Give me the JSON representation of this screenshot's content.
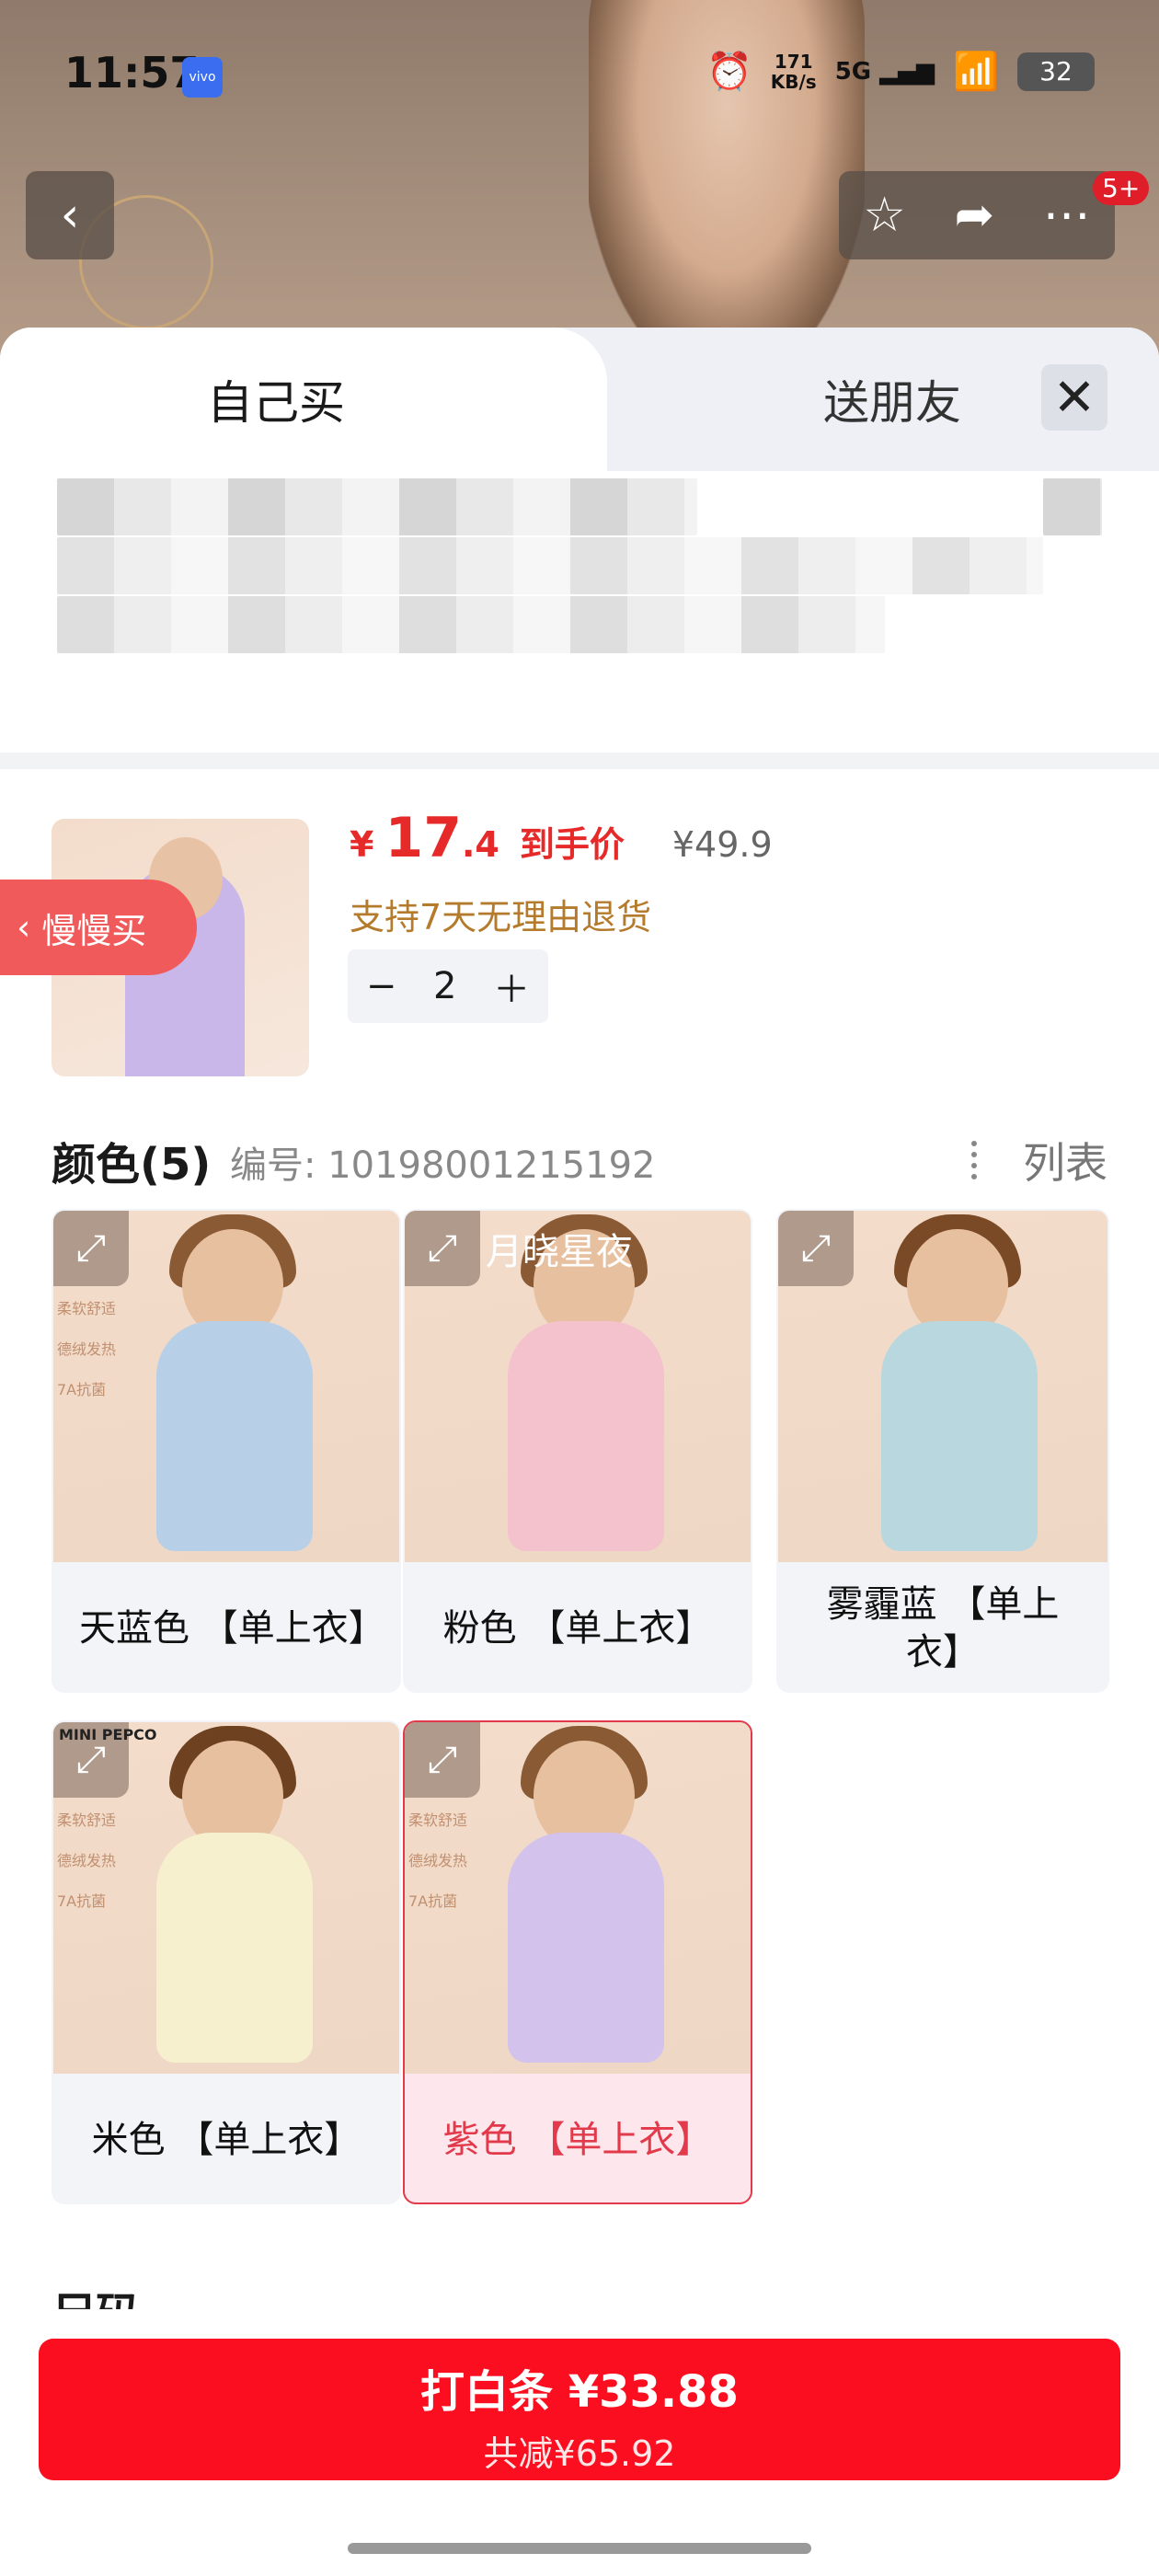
{
  "status_bar": {
    "time": "11:57",
    "network_speed": "171\nKB/s",
    "signal": "5G",
    "battery": "32"
  },
  "top_bar": {
    "badge": "5+"
  },
  "tabs": {
    "self": "自己买",
    "friend": "送朋友"
  },
  "product": {
    "yen": "¥",
    "price_int": "17",
    "price_dec": ".4",
    "price_label": "到手价",
    "original_price": "¥49.9",
    "refund_policy": "支持7天无理由退货",
    "quantity": "2",
    "slow_buy": "慢慢买"
  },
  "color_section": {
    "title": "颜色(5)",
    "code": "编号: 10198001215192",
    "list_toggle": "列表",
    "options": [
      {
        "label": "天蓝色 【单上衣】",
        "color": "#b8cfe8",
        "selected": false
      },
      {
        "label": "粉色 【单上衣】",
        "color": "#f3c2cc",
        "selected": false,
        "overlay": "月晓星夜"
      },
      {
        "label": "雾霾蓝 【单上衣】",
        "color": "#b9d7de",
        "selected": false
      },
      {
        "label": "米色 【单上衣】",
        "color": "#f6f0cf",
        "selected": false,
        "brand": "MINI PEPCO"
      },
      {
        "label": "紫色 【单上衣】",
        "color": "#d3c3ec",
        "selected": true
      }
    ]
  },
  "size_section": {
    "title": "尺码"
  },
  "footer": {
    "button_main": "打白条 ¥33.88",
    "button_sub": "共减¥65.92"
  },
  "thumb_badges": [
    "柔软舒适",
    "德绒发热",
    "7A抗菌"
  ]
}
